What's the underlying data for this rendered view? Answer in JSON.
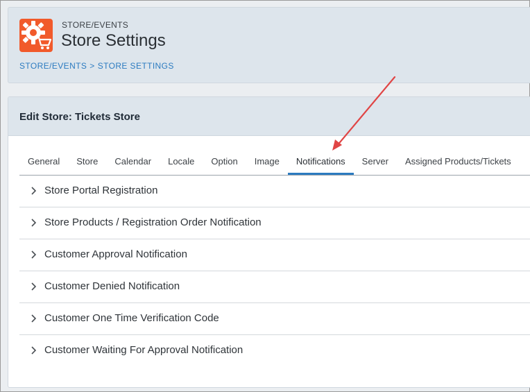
{
  "header": {
    "eyebrow": "STORE/EVENTS",
    "title": "Store Settings",
    "breadcrumb": {
      "root": "STORE/EVENTS",
      "separator": ">",
      "current": "STORE SETTINGS"
    },
    "logo_icon": "store-gear-cart-icon",
    "brand_color": "#f15a2b"
  },
  "panel": {
    "title": "Edit Store: Tickets Store"
  },
  "tabs": [
    {
      "label": "General"
    },
    {
      "label": "Store"
    },
    {
      "label": "Calendar"
    },
    {
      "label": "Locale"
    },
    {
      "label": "Option"
    },
    {
      "label": "Image"
    },
    {
      "label": "Notifications",
      "active": true
    },
    {
      "label": "Server"
    },
    {
      "label": "Assigned Products/Tickets"
    }
  ],
  "accordion": [
    {
      "label": "Store Portal Registration"
    },
    {
      "label": "Store Products / Registration Order Notification"
    },
    {
      "label": "Customer Approval Notification"
    },
    {
      "label": "Customer Denied Notification"
    },
    {
      "label": "Customer One Time Verification Code"
    },
    {
      "label": "Customer Waiting For Approval Notification"
    }
  ],
  "colors": {
    "accent": "#2c7bc0",
    "annotation_arrow": "#e04545"
  }
}
